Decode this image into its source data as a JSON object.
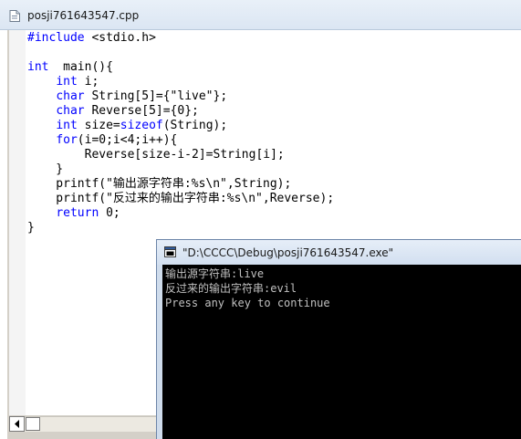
{
  "editor": {
    "title": "posji761643547.cpp",
    "icon": "file-icon",
    "code_lines": [
      "#include <stdio.h>",
      "",
      "int  main(){",
      "    int i;",
      "    char String[5]={\"live\"};",
      "    char Reverse[5]={0};",
      "    int size=sizeof(String);",
      "    for(i=0;i<4;i++){",
      "        Reverse[size-i-2]=String[i];",
      "    }",
      "    printf(\"输出源字符串:%s\\n\",String);",
      "    printf(\"反过来的输出字符串:%s\\n\",Reverse);",
      "    return 0;",
      "}"
    ]
  },
  "console": {
    "title": "\"D:\\CCCC\\Debug\\posji761643547.exe\"",
    "icon": "console-icon",
    "output_lines": [
      "输出源字符串:live",
      "反过来的输出字符串:evil",
      "Press any key to continue"
    ]
  },
  "colors": {
    "keyword": "#0000ff",
    "console_bg": "#000000",
    "console_text": "#c0c0c0"
  }
}
